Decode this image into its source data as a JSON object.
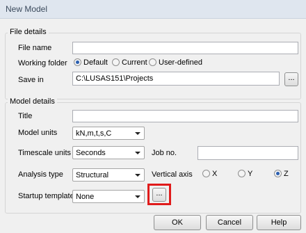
{
  "window": {
    "title": "New Model"
  },
  "file_details": {
    "legend": "File details",
    "file_name_label": "File name",
    "file_name_value": "",
    "working_folder_label": "Working folder",
    "working_folder_options": [
      "Default",
      "Current",
      "User-defined"
    ],
    "working_folder_selected": "Default",
    "save_in_label": "Save in",
    "save_in_value": "C:\\LUSAS151\\Projects",
    "browse_label": "..."
  },
  "model_details": {
    "legend": "Model details",
    "title_label": "Title",
    "title_value": "",
    "model_units_label": "Model units",
    "model_units_value": "kN,m,t,s,C",
    "timescale_units_label": "Timescale units",
    "timescale_units_value": "Seconds",
    "job_no_label": "Job no.",
    "job_no_value": "",
    "analysis_type_label": "Analysis type",
    "analysis_type_value": "Structural",
    "vertical_axis_label": "Vertical axis",
    "vertical_axis_options": [
      "X",
      "Y",
      "Z"
    ],
    "vertical_axis_selected": "Z",
    "startup_template_label": "Startup template",
    "startup_template_value": "None",
    "startup_browse_label": "..."
  },
  "buttons": {
    "ok": "OK",
    "cancel": "Cancel",
    "help": "Help"
  },
  "colors": {
    "highlight": "#e01b1b",
    "radio_selected": "#2b5fb0"
  }
}
